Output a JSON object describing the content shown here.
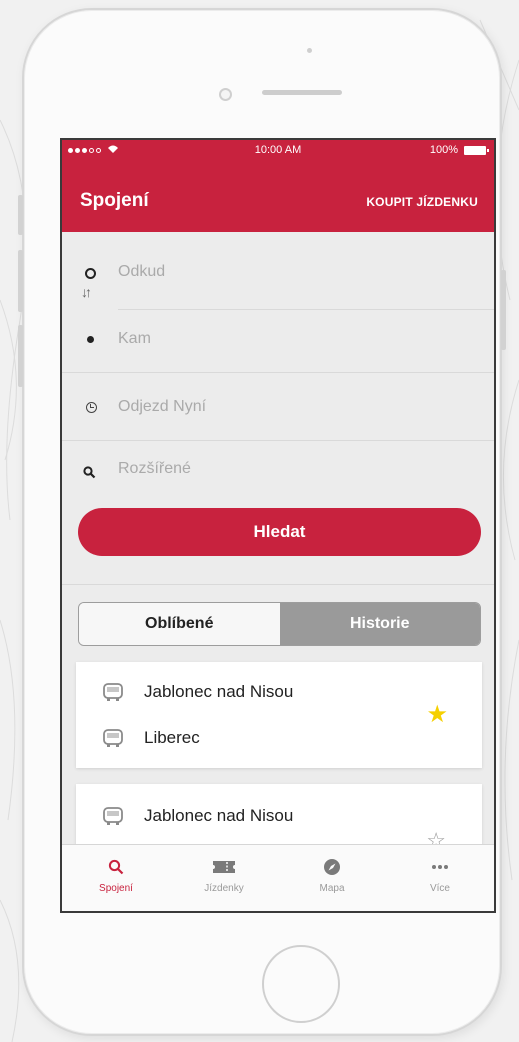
{
  "status_bar": {
    "signal": "●●●○○",
    "time": "10:00 AM",
    "battery": "100%"
  },
  "header": {
    "title": "Spojení",
    "action": "KOUPIT JÍZDENKU"
  },
  "search_form": {
    "from_placeholder": "Odkud",
    "to_placeholder": "Kam",
    "departure": "Odjezd Nyní",
    "advanced": "Rozšířené",
    "search_button": "Hledat"
  },
  "segment": {
    "favorites": "Oblíbené",
    "history": "Historie",
    "selected": "Historie"
  },
  "connections": [
    {
      "from": "Jablonec nad Nisou",
      "to": "Liberec",
      "favorite": true
    },
    {
      "from": "Jablonec nad Nisou",
      "to": "",
      "favorite": false
    }
  ],
  "tabs": [
    {
      "label": "Spojení",
      "icon": "search-icon",
      "active": true
    },
    {
      "label": "Jízdenky",
      "icon": "ticket-icon",
      "active": false
    },
    {
      "label": "Mapa",
      "icon": "compass-icon",
      "active": false
    },
    {
      "label": "Více",
      "icon": "more-icon",
      "active": false
    }
  ],
  "colors": {
    "brand": "#c8223e",
    "star_active": "#f5d000",
    "star_inactive": "#9a9a9a"
  }
}
